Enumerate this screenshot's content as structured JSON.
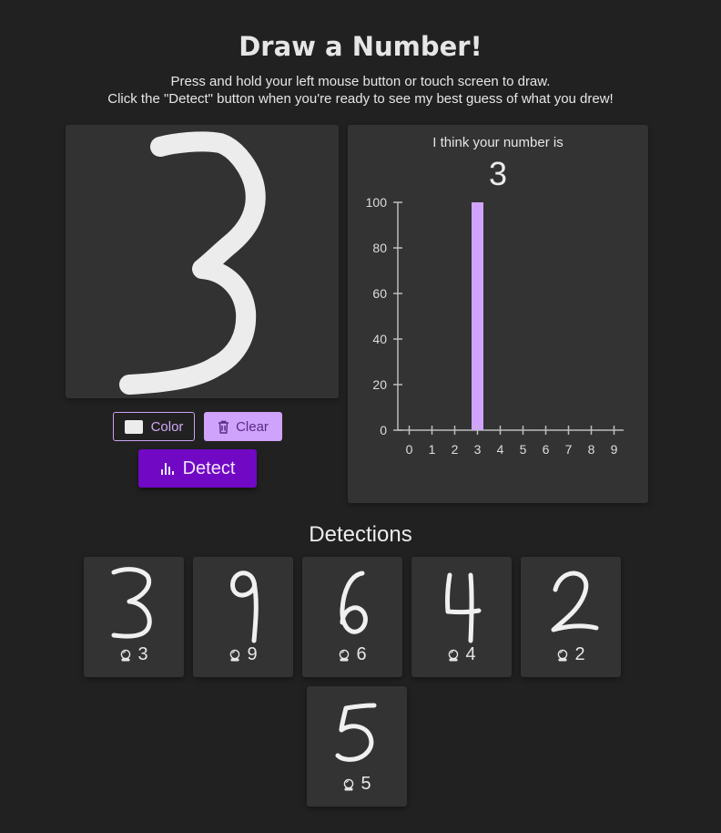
{
  "header": {
    "title": "Draw a Number!",
    "instruction_line1": "Press and hold your left mouse button or touch screen to draw.",
    "instruction_line2": "Click the \"Detect\" button when you're ready to see my best guess of what you drew!"
  },
  "canvas": {
    "background_color": "#323232",
    "stroke_color": "#ececec"
  },
  "controls": {
    "color_label": "Color",
    "clear_label": "Clear",
    "detect_label": "Detect",
    "clear_icon": "trash-icon",
    "detect_icon": "bar-chart-icon"
  },
  "result": {
    "label": "I think your number is",
    "digit": "3"
  },
  "chart_data": {
    "type": "bar",
    "categories": [
      "0",
      "1",
      "2",
      "3",
      "4",
      "5",
      "6",
      "7",
      "8",
      "9"
    ],
    "values": [
      0,
      0,
      0,
      100,
      0,
      0,
      0,
      0,
      0,
      0
    ],
    "yticks": [
      "0",
      "20",
      "40",
      "60",
      "80",
      "100"
    ],
    "ylim": [
      0,
      100
    ],
    "bar_color": "#d0a4fc",
    "grid": false,
    "title": "",
    "xlabel": "",
    "ylabel": ""
  },
  "detections": {
    "heading": "Detections",
    "icon": "crystal-ball-icon",
    "items": [
      {
        "guess": "3"
      },
      {
        "guess": "9"
      },
      {
        "guess": "6"
      },
      {
        "guess": "4"
      },
      {
        "guess": "2"
      },
      {
        "guess": "5"
      }
    ]
  }
}
